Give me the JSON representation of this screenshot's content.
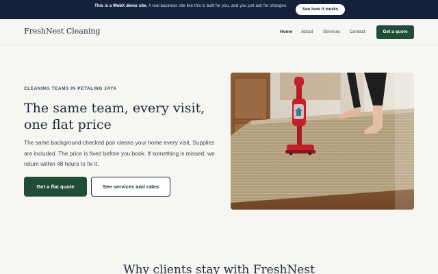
{
  "banner": {
    "bold_text": "This is a WebX demo site.",
    "text": " A real business site like this is built for you, and you just ask for changes.",
    "button_label": "See how it works"
  },
  "header": {
    "logo": "FreshNest Cleaning",
    "nav": [
      "Home",
      "About",
      "Services",
      "Contact"
    ],
    "cta_label": "Get a quote"
  },
  "hero": {
    "eyebrow": "CLEANING TEAMS IN PETALING JAYA",
    "headline": "The same team, every visit, one flat price",
    "body": "The same background-checked pair cleans your home every visit. Supplies are included. The price is fixed before you book. If something is missed, we return within 48 hours to fix it.",
    "primary_button": "Get a flat quote",
    "secondary_button": "See services and rates",
    "image_icon": "house-icon"
  },
  "section": {
    "heading": "Why clients stay with FreshNest"
  },
  "colors": {
    "banner_bg": "#14213a",
    "accent": "#1f4d36",
    "page_bg": "#f7f6f2",
    "vacuum_red": "#c4202a"
  }
}
